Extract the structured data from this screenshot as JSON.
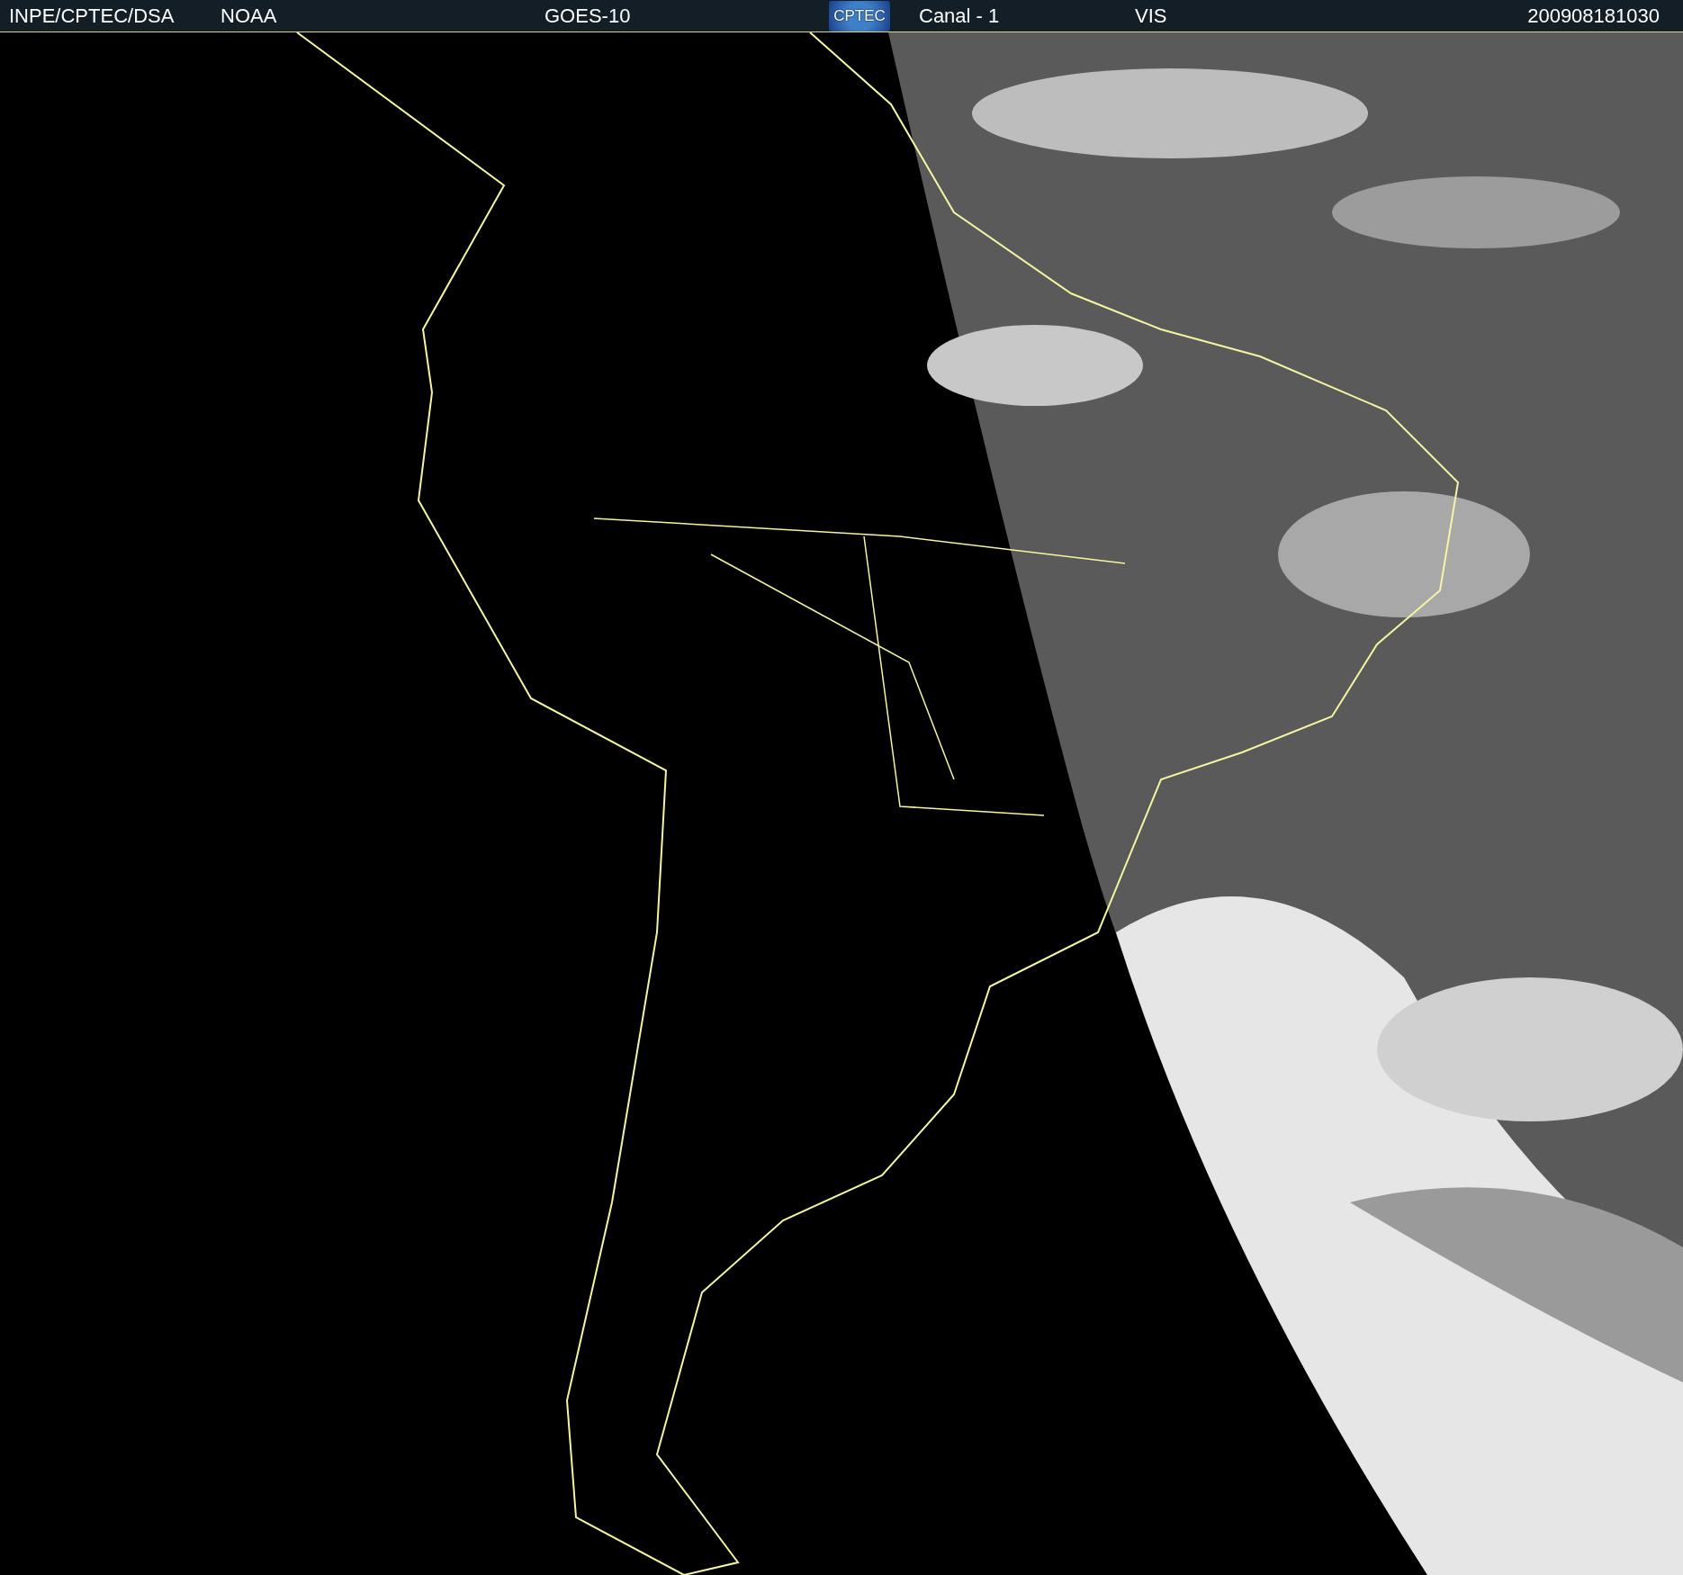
{
  "header": {
    "source": "INPE/CPTEC/DSA",
    "agency": "NOAA",
    "satellite": "GOES-10",
    "logo": "CPTEC",
    "channel": "Canal - 1",
    "band": "VIS",
    "timestamp": "200908181030"
  }
}
